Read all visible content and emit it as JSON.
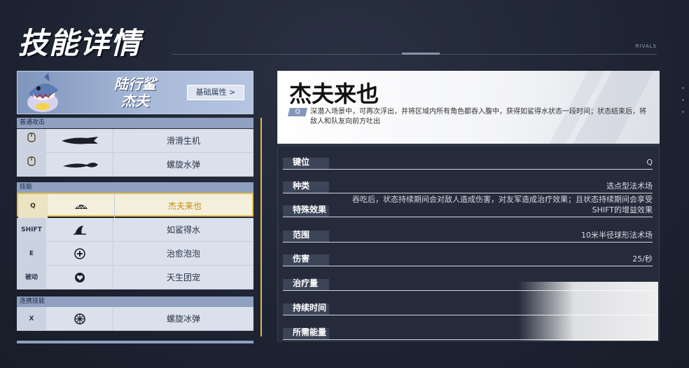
{
  "page": {
    "title": "技能详情",
    "corner_tag": "RIVALS"
  },
  "character": {
    "name_line1": "陆行鲨",
    "name_line2": "杰夫",
    "attr_button": "基础属性 >"
  },
  "skill_groups": [
    {
      "label": "普通攻击",
      "skills": [
        {
          "key": "",
          "name": "滑滑生机",
          "icon": "weapon-icon"
        },
        {
          "key": "",
          "name": "螺旋水弹",
          "icon": "water-blast-icon"
        }
      ]
    },
    {
      "label": "技能",
      "skills": [
        {
          "key": "Q",
          "name": "杰夫来也",
          "icon": "shark-mouth-icon",
          "selected": true
        },
        {
          "key": "SHIFT",
          "name": "如鲨得水",
          "icon": "fin-icon"
        },
        {
          "key": "E",
          "name": "治愈泡泡",
          "icon": "heal-bubble-icon"
        },
        {
          "key": "被动",
          "name": "天生团宠",
          "icon": "heart-icon"
        }
      ]
    },
    {
      "label": "连携技能",
      "skills": [
        {
          "key": "X",
          "name": "螺旋冰弹",
          "icon": "ice-bomb-icon"
        }
      ]
    }
  ],
  "detail": {
    "title": "杰夫来也",
    "key_tag": "Q",
    "description": "深潜入场景中，可再次浮出，并将区域内所有角色都吞入腹中，获得如鲨得水状态一段时间；状态结束后，将敌人和队友向前方吐出",
    "properties": [
      {
        "label": "键位",
        "value": "Q"
      },
      {
        "label": "种类",
        "value": "选点型法术场"
      },
      {
        "label": "特殊效果",
        "value": "吞吃后，状态持续期间会对敌人造成伤害，对友军造成治疗效果；且状态持续期间会享受SHIFT的增益效果"
      },
      {
        "label": "范围",
        "value": "10米半径球形法术场"
      },
      {
        "label": "伤害",
        "value": "25/秒"
      },
      {
        "label": "治疗量",
        "value": ""
      },
      {
        "label": "持续时间",
        "value": ""
      },
      {
        "label": "所需能量",
        "value": ""
      }
    ]
  }
}
